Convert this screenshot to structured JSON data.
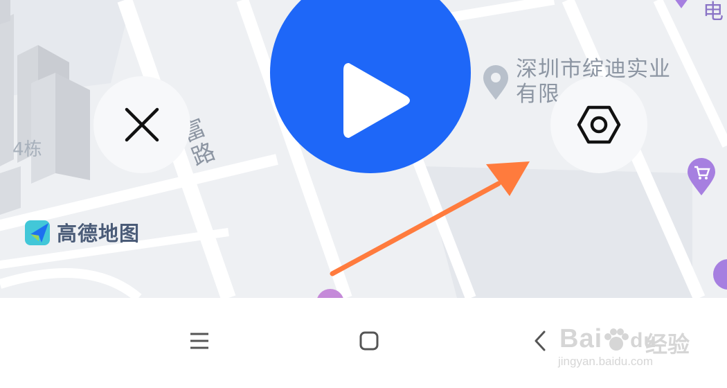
{
  "map": {
    "poi_name": "深圳市绽迪实业有限",
    "poi_partial_top_right": "电",
    "building_label": "4栋",
    "road_label": "富路",
    "brand_logo_text": "高德地图"
  },
  "controls": {
    "close_icon": "close-icon",
    "play_icon": "play-icon",
    "settings_icon": "hexagon-nut-settings-icon",
    "play_color": "#1e67f8",
    "arrow_color": "#ff7b3d"
  },
  "navbar": {
    "items": [
      "menu-icon",
      "home-square-icon",
      "back-chevron-icon"
    ]
  },
  "watermark": {
    "brand": "Bai",
    "brand_suffix": "du",
    "brand_cn": "经验",
    "url": "jingyan.baidu.com"
  }
}
